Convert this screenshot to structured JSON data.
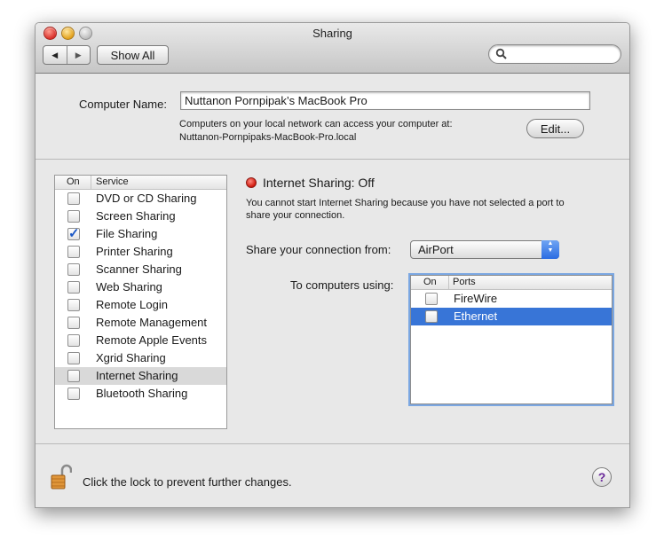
{
  "window": {
    "title": "Sharing"
  },
  "toolbar": {
    "back_icon": "◀",
    "forward_icon": "▶",
    "show_all_label": "Show All",
    "search_placeholder": ""
  },
  "computer_name": {
    "label": "Computer Name:",
    "value": "Nuttanon Pornpipak’s MacBook Pro",
    "help_line1": "Computers on your local network can access your computer at:",
    "help_line2": "Nuttanon-Pornpipaks-MacBook-Pro.local",
    "edit_label": "Edit..."
  },
  "service_list": {
    "header_on": "On",
    "header_service": "Service",
    "items": [
      {
        "label": "DVD or CD Sharing",
        "checked": false,
        "selected": false
      },
      {
        "label": "Screen Sharing",
        "checked": false,
        "selected": false
      },
      {
        "label": "File Sharing",
        "checked": true,
        "selected": false
      },
      {
        "label": "Printer Sharing",
        "checked": false,
        "selected": false
      },
      {
        "label": "Scanner Sharing",
        "checked": false,
        "selected": false
      },
      {
        "label": "Web Sharing",
        "checked": false,
        "selected": false
      },
      {
        "label": "Remote Login",
        "checked": false,
        "selected": false
      },
      {
        "label": "Remote Management",
        "checked": false,
        "selected": false
      },
      {
        "label": "Remote Apple Events",
        "checked": false,
        "selected": false
      },
      {
        "label": "Xgrid Sharing",
        "checked": false,
        "selected": false
      },
      {
        "label": "Internet Sharing",
        "checked": false,
        "selected": true
      },
      {
        "label": "Bluetooth Sharing",
        "checked": false,
        "selected": false
      }
    ]
  },
  "detail": {
    "status_text": "Internet Sharing: Off",
    "status_color": "#d0180c",
    "description_line1": "You cannot start Internet Sharing because you have not selected a port to",
    "description_line2": "share your connection.",
    "share_from_label": "Share your connection from:",
    "share_from_value": "AirPort",
    "to_computers_label": "To computers using:",
    "ports_header_on": "On",
    "ports_header_ports": "Ports",
    "ports": [
      {
        "label": "FireWire",
        "checked": false,
        "selected": false
      },
      {
        "label": "Ethernet",
        "checked": false,
        "selected": true
      }
    ]
  },
  "bottom": {
    "lock_text": "Click the lock to prevent further changes.",
    "help_label": "?"
  },
  "colors": {
    "selection_blue": "#3875d7",
    "focus_ring": "#7ba7e2"
  }
}
